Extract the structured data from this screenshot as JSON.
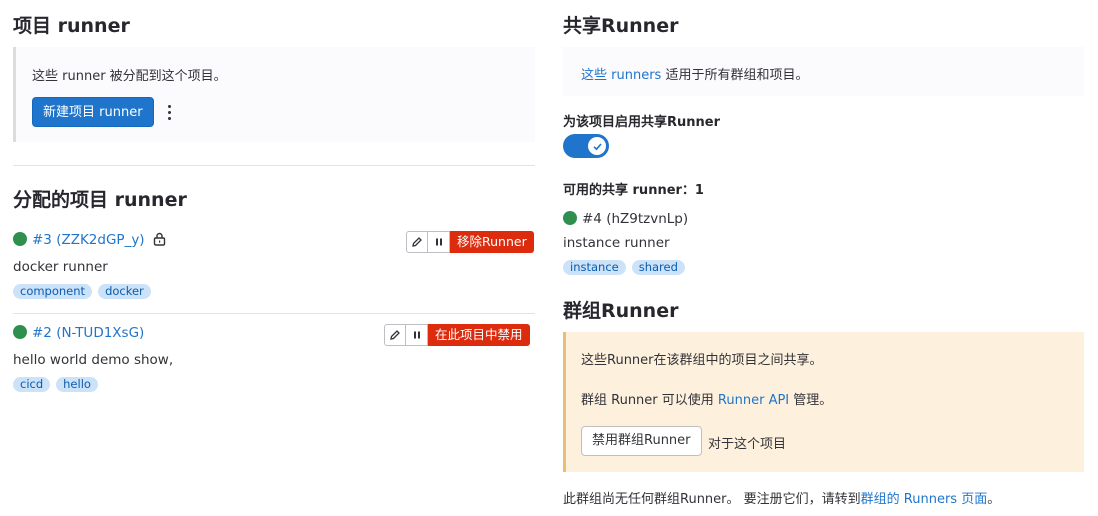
{
  "project_runners": {
    "title": "项目 runner",
    "info": "这些 runner 被分配到这个项目。",
    "new_button": "新建项目 runner"
  },
  "assigned": {
    "title": "分配的项目 runner",
    "runners": [
      {
        "id_label": "#3 (ZZK2dGP_y)",
        "description": "docker runner",
        "tags": [
          "component",
          "docker"
        ],
        "danger_label": "移除Runner",
        "locked": true
      },
      {
        "id_label": "#2 (N-TUD1XsG)",
        "description": "hello world demo show,",
        "tags": [
          "cicd",
          "hello"
        ],
        "danger_label": "在此项目中禁用",
        "locked": false
      }
    ]
  },
  "shared": {
    "title": "共享Runner",
    "info_link": "这些 runners",
    "info_rest": " 适用于所有群组和项目。",
    "toggle_label": "为该项目启用共享Runner",
    "toggle_on": true,
    "available_label": "可用的共享 runner：1",
    "runner": {
      "id_label": "#4 (hZ9tzvnLp)",
      "description": "instance runner",
      "tags": [
        "instance",
        "shared"
      ]
    }
  },
  "group": {
    "title": "群组Runner",
    "info_line1": "这些Runner在该群组中的项目之间共享。",
    "info_line2_pre": "群组 Runner 可以使用 ",
    "info_line2_link": "Runner API",
    "info_line2_post": " 管理。",
    "disable_button": "禁用群组Runner",
    "disable_suffix": "对于这个项目",
    "footer_pre": "此群组尚无任何群组Runner。 要注册它们，请转到",
    "footer_link": "群组的 Runners 页面",
    "footer_post": "。"
  },
  "colors": {
    "primary": "#1f75cb",
    "danger": "#dd2b0e",
    "online": "#2f8f4e",
    "tag_bg": "#cbe2f9",
    "warning_bg": "#fdf1dd"
  },
  "icons": [
    "kebab-menu-icon",
    "lock-icon",
    "pencil-icon",
    "pause-icon",
    "check-icon"
  ]
}
